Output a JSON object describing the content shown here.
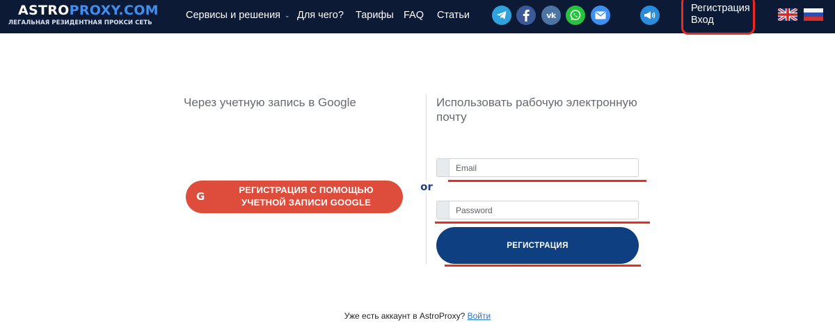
{
  "header": {
    "logo": {
      "part1": "ASTRO",
      "part2": "PROXY.COM",
      "tagline": "ЛЕГАЛЬНАЯ РЕЗИДЕНТНАЯ ПРОКСИ СЕТЬ"
    },
    "nav": [
      {
        "label": "Сервисы и решения",
        "has_dropdown": true
      },
      {
        "label": "Для чего?"
      },
      {
        "label": "Тарифы"
      },
      {
        "label": "FAQ"
      },
      {
        "label": "Статьи"
      }
    ],
    "social_icons": [
      {
        "name": "telegram-icon",
        "color": "#2ea3dc"
      },
      {
        "name": "facebook-icon",
        "color": "#3b5998"
      },
      {
        "name": "vk-icon",
        "color": "#4c75a3"
      },
      {
        "name": "whatsapp-icon",
        "color": "#27c33f"
      },
      {
        "name": "email-icon",
        "color": "#3d8ff0"
      },
      {
        "name": "megaphone-icon",
        "color": "#2a8cdb"
      }
    ],
    "auth": {
      "register": "Регистрация",
      "login": "Вход"
    },
    "languages": [
      "en",
      "ru"
    ]
  },
  "main": {
    "google_col": {
      "title": "Через учетную запись в Google",
      "button_icon": "G",
      "button_label": "РЕГИСТРАЦИЯ С ПОМОЩЬЮ УЧЕТНОЙ ЗАПИСИ GOOGLE"
    },
    "separator": "or",
    "email_col": {
      "title": "Использовать рабочую электронную почту",
      "email_placeholder": "Email",
      "password_placeholder": "Password",
      "submit_label": "РЕГИСТРАЦИЯ"
    }
  },
  "footer": {
    "question": "Уже есть аккаунт в AstroProxy?",
    "login_link": "Войти"
  },
  "colors": {
    "header_bg": "#0c1a36",
    "brand_blue": "#3d8ff0",
    "google_red": "#de4c3c",
    "primary_button": "#0e3f80",
    "annotation_red": "#ee2a1e",
    "link": "#2176d2"
  }
}
